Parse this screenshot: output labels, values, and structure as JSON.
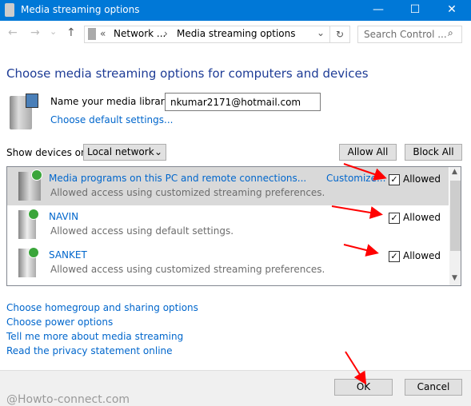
{
  "window": {
    "title": "Media streaming options",
    "minimize": "—",
    "maximize": "☐",
    "close": "✕"
  },
  "nav": {
    "back": "←",
    "forward": "→",
    "recent": "⌄",
    "up": "↑",
    "breadcrumb_prefix": "«",
    "breadcrumb": [
      "Network ...",
      "Media streaming options"
    ],
    "separator": "›",
    "dropdown": "⌄",
    "refresh": "↻",
    "search_placeholder": "Search Control ...",
    "search_icon": "⌕"
  },
  "main": {
    "heading": "Choose media streaming options for computers and devices",
    "library_label": "Name your media library:",
    "library_value": "nkumar2171@hotmail.com",
    "default_settings_link": "Choose default settings...",
    "show_devices_label": "Show devices on:",
    "show_devices_value": "Local network",
    "allow_all": "Allow All",
    "block_all": "Block All",
    "devices": [
      {
        "name": "Media programs on this PC and remote connections...",
        "desc": "Allowed access using customized streaming preferences.",
        "customize": "Customize...",
        "allowed_label": "Allowed",
        "checked": true,
        "selected": true
      },
      {
        "name": "NAVIN",
        "desc": "Allowed access using default settings.",
        "allowed_label": "Allowed",
        "checked": true
      },
      {
        "name": "SANKET",
        "desc": "Allowed access using customized streaming preferences.",
        "allowed_label": "Allowed",
        "checked": true
      }
    ],
    "links": [
      "Choose homegroup and sharing options",
      "Choose power options",
      "Tell me more about media streaming",
      "Read the privacy statement online"
    ]
  },
  "footer": {
    "ok": "OK",
    "cancel": "Cancel"
  },
  "watermark": "@Howto-connect.com",
  "colors": {
    "titlebar": "#0078d7",
    "link": "#0066cc",
    "heading": "#1e3c96",
    "annotation_arrow": "#ff0000"
  }
}
